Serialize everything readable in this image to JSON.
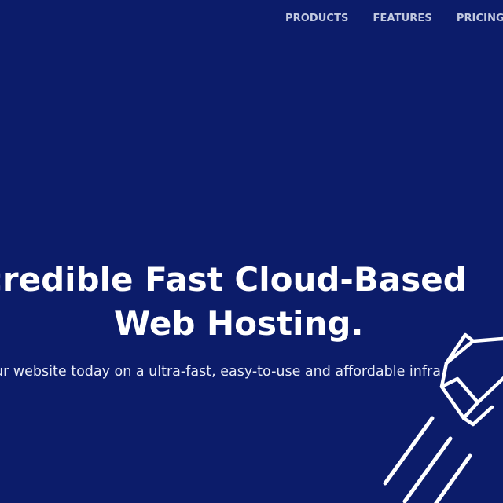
{
  "nav": {
    "items": [
      {
        "label": "PRODUCTS"
      },
      {
        "label": "FEATURES"
      },
      {
        "label": "PRICING"
      }
    ]
  },
  "hero": {
    "title_line_1": "credible Fast Cloud-Based",
    "title_line_2": "Web Hosting.",
    "subtitle": "ur website today on a ultra-fast, easy-to-use and affordable infra"
  },
  "illustration": {
    "icon": "rocket-icon",
    "color": "#ffffff"
  },
  "colors": {
    "background": "#0c1c6a",
    "nav_text": "#c2c9e0",
    "title": "#ffffff"
  }
}
